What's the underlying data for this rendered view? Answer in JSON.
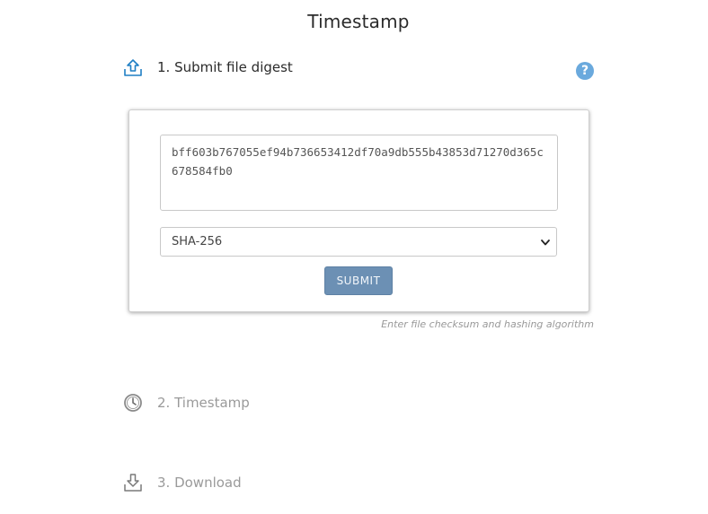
{
  "page": {
    "title": "Timestamp"
  },
  "steps": [
    {
      "label": "1. Submit file digest",
      "icon": "upload-icon",
      "active": true
    },
    {
      "label": "2. Timestamp",
      "icon": "clock-icon",
      "active": false
    },
    {
      "label": "3. Download",
      "icon": "download-icon",
      "active": false
    }
  ],
  "help": {
    "glyph": "?",
    "icon": "help-icon"
  },
  "form": {
    "digest_value": "bff603b767055ef94b736653412df70a9db555b43853d71270d365c678584fb0",
    "algorithm_selected": "SHA-256",
    "submit_label": "SUBMIT",
    "hint": "Enter file checksum and hashing algorithm"
  },
  "colors": {
    "accent": "#1f7fc4",
    "help_bg": "#6aa9dd",
    "submit_bg": "#6c90b4",
    "inactive_text": "#9a9a9a"
  }
}
